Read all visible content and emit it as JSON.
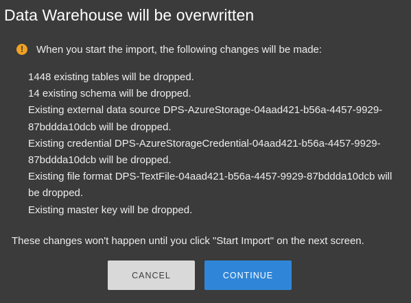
{
  "dialog": {
    "title": "Data Warehouse will be overwritten",
    "warning": {
      "icon": "warning-icon",
      "icon_glyph": "!",
      "text": "When you start the import, the following changes will be made:"
    },
    "changes": [
      "1448 existing tables will be dropped.",
      "14 existing schema will be dropped.",
      "Existing external data source DPS-AzureStorage-04aad421-b56a-4457-9929-87bddda10dcb will be dropped.",
      "Existing credential DPS-AzureStorageCredential-04aad421-b56a-4457-9929-87bddda10dcb will be dropped.",
      "Existing file format DPS-TextFile-04aad421-b56a-4457-9929-87bddda10dcb will be dropped.",
      "Existing master key will be dropped."
    ],
    "note": "These changes won't happen until you click \"Start Import\" on the next screen.",
    "buttons": {
      "cancel": "CANCEL",
      "continue": "CONTINUE"
    }
  },
  "colors": {
    "background": "#3b3b3b",
    "warning_accent": "#f0a223",
    "primary_button": "#2f86d8",
    "secondary_button": "#d9d9d9"
  }
}
